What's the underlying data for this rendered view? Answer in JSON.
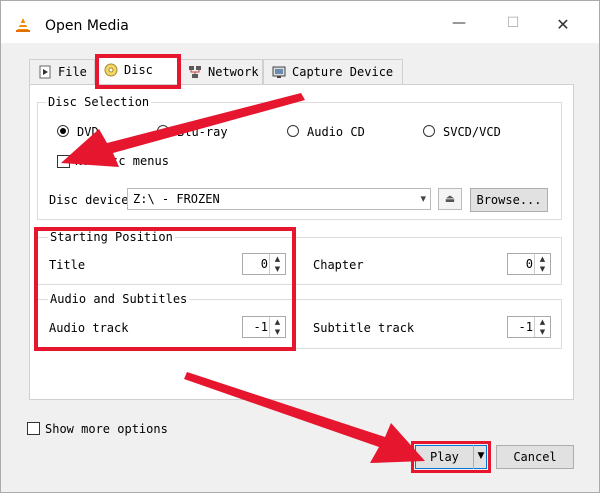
{
  "window": {
    "title": "Open Media",
    "minimize": "—",
    "maximize": "☐",
    "close": "✕"
  },
  "tabs": [
    {
      "label": "File",
      "icon": "file-play-icon"
    },
    {
      "label": "Disc",
      "icon": "disc-icon",
      "active": true
    },
    {
      "label": "Network",
      "icon": "network-icon"
    },
    {
      "label": "Capture Device",
      "icon": "capture-device-icon"
    }
  ],
  "disc_selection": {
    "title": "Disc Selection",
    "options": [
      {
        "label": "DVD",
        "selected": true
      },
      {
        "label": "Blu-ray",
        "selected": false
      },
      {
        "label": "Audio CD",
        "selected": false
      },
      {
        "label": "SVCD/VCD",
        "selected": false
      }
    ],
    "no_menus_label": "No disc menus",
    "no_menus_checked": false,
    "device_label": "Disc device",
    "device_value": "Z:\\ - FROZEN",
    "browse_label": "Browse..."
  },
  "starting_position": {
    "title": "Starting Position",
    "title_label": "Title",
    "title_value": "0",
    "chapter_label": "Chapter",
    "chapter_value": "0"
  },
  "audio_subtitles": {
    "title": "Audio and Subtitles",
    "audio_label": "Audio track",
    "audio_value": "-1",
    "subtitle_label": "Subtitle track",
    "subtitle_value": "-1"
  },
  "footer": {
    "show_more_label": "Show more options",
    "show_more_checked": false,
    "play_label": "Play",
    "cancel_label": "Cancel"
  },
  "colors": {
    "annotation_red": "#e6162f",
    "accent": "#0078d7"
  }
}
